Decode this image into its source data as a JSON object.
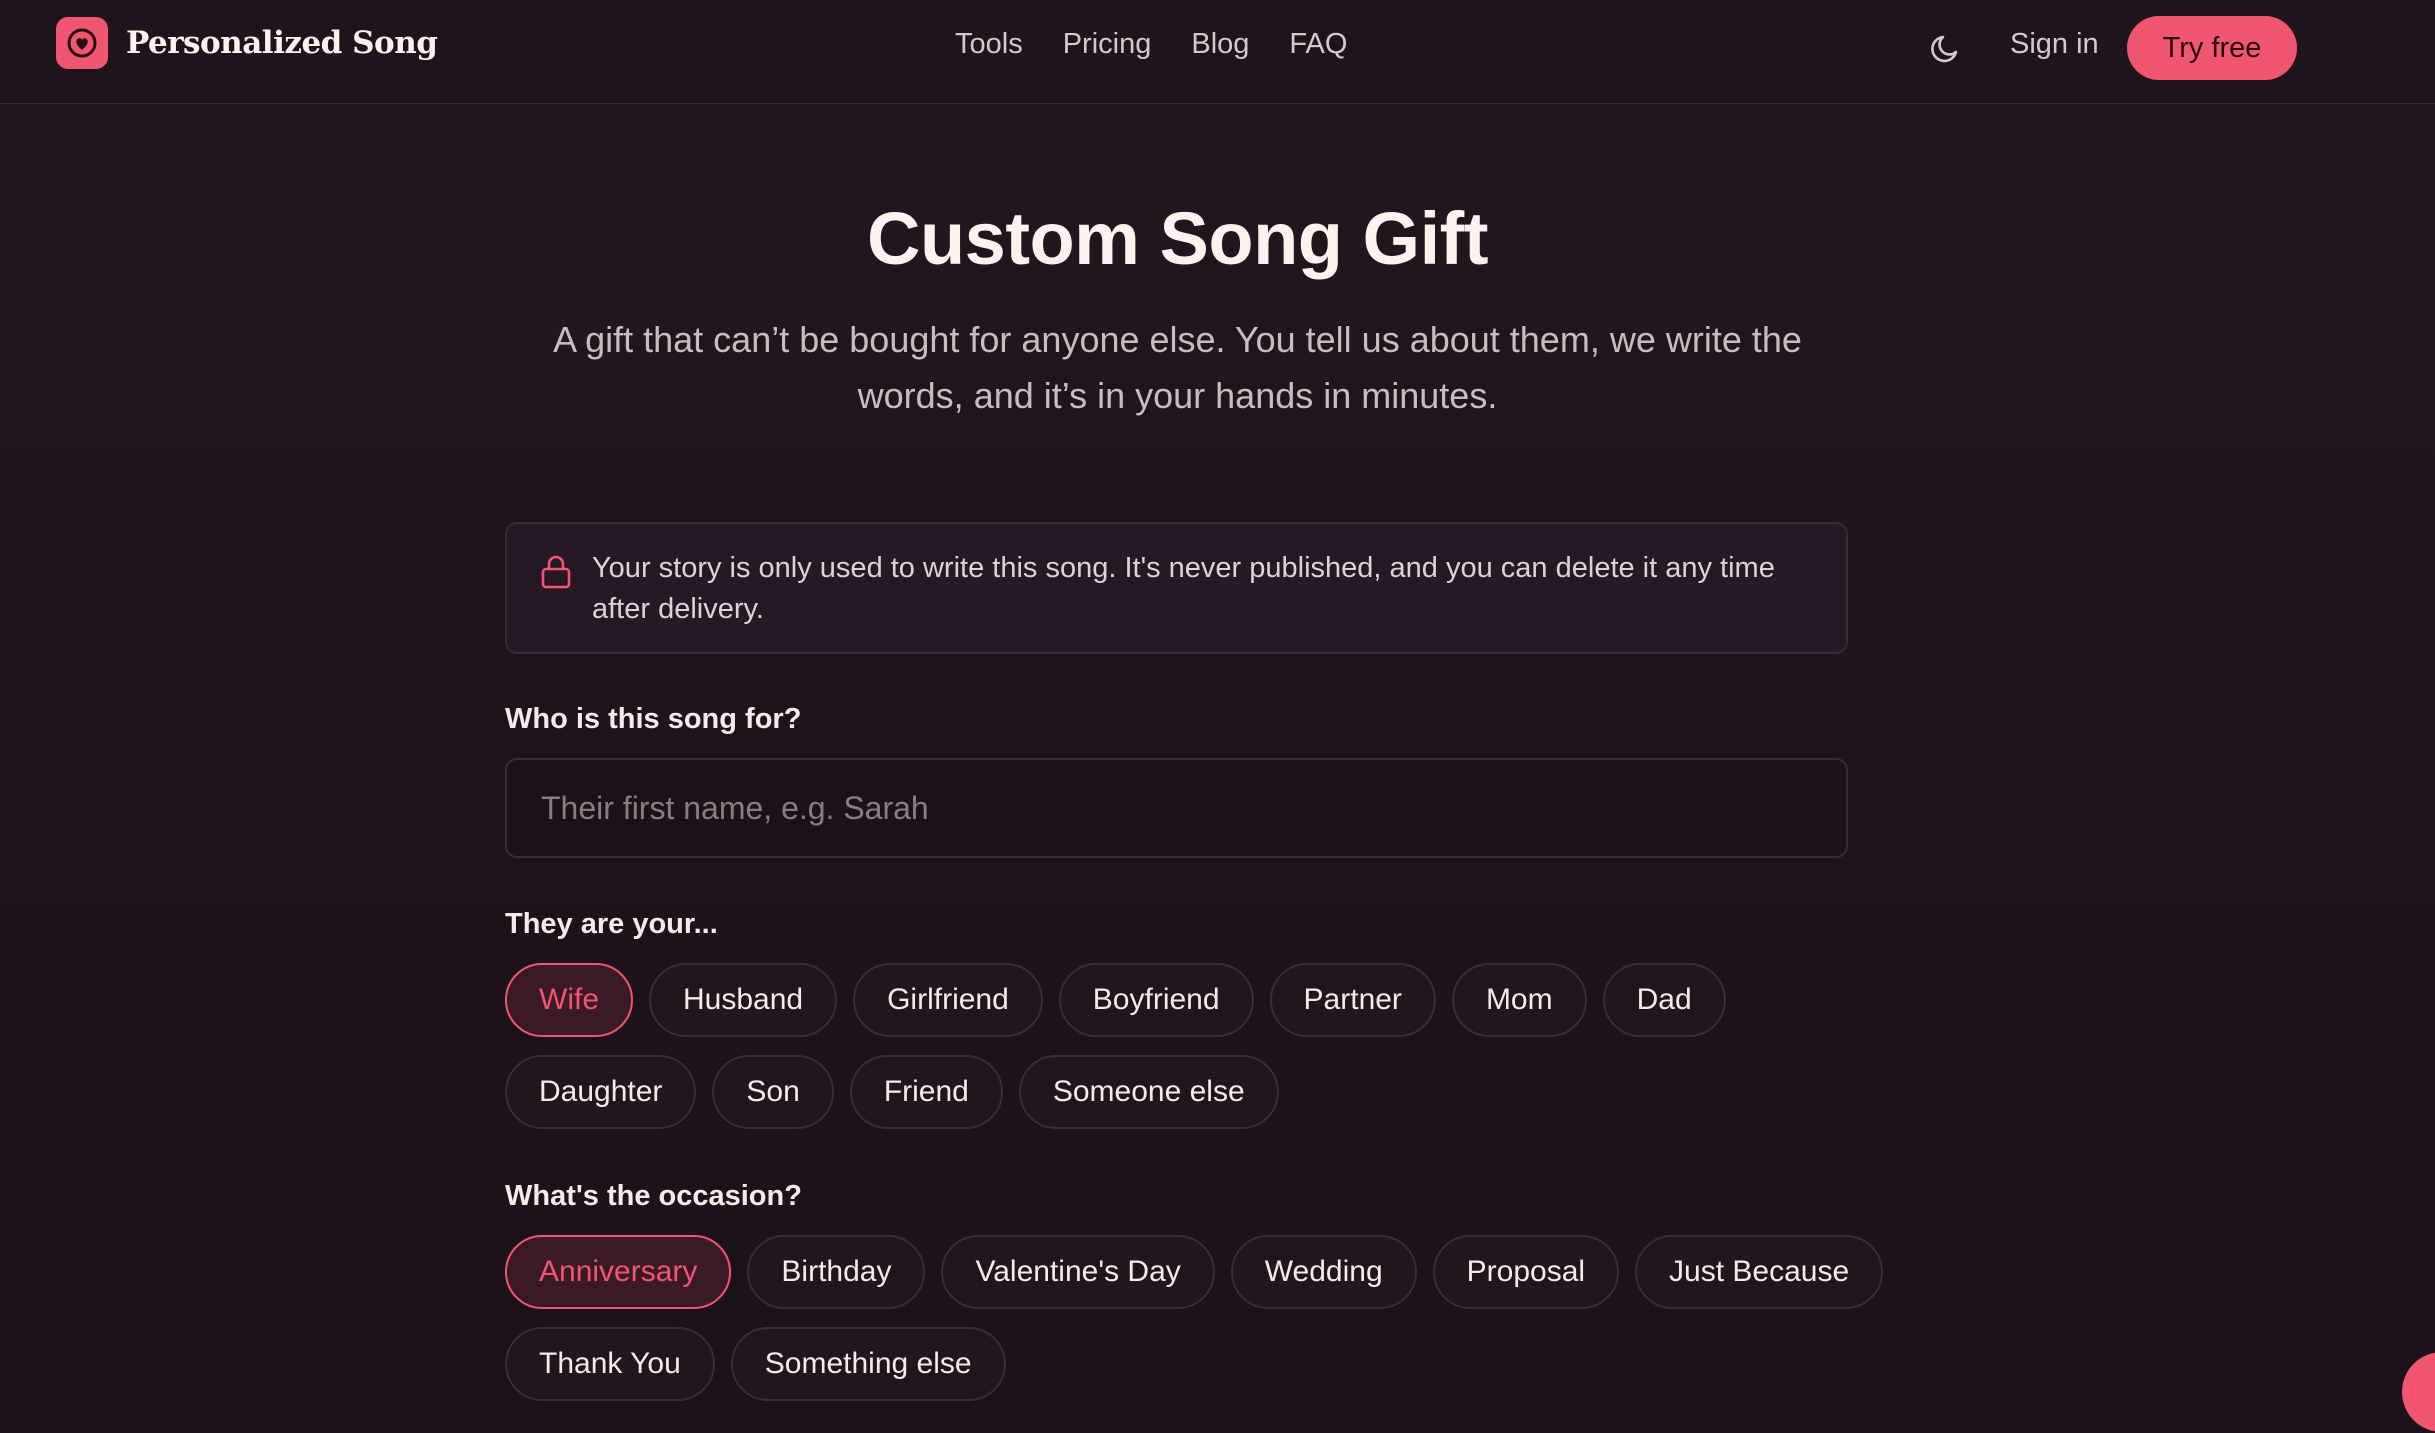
{
  "brand": {
    "name": "Personalized Song",
    "logo_icon": "heart-icon",
    "accent_color": "#f0566f"
  },
  "nav": {
    "items": [
      "Tools",
      "Pricing",
      "Blog",
      "FAQ"
    ],
    "theme_icon": "moon-icon",
    "signin_label": "Sign in",
    "try_label": "Try free"
  },
  "hero": {
    "title": "Custom Song Gift",
    "subtitle": "A gift that can’t be bought for anyone else. You tell us about them, we write the words, and it’s in your hands in minutes."
  },
  "notice": {
    "icon": "lock-icon",
    "text": "Your story is only used to write this song. It's never published, and you can delete it any time after delivery."
  },
  "form": {
    "name_label": "Who is this song for?",
    "name_placeholder": "Their first name, e.g. Sarah",
    "name_value": "",
    "relation_label": "They are your...",
    "relations": [
      "Wife",
      "Husband",
      "Girlfriend",
      "Boyfriend",
      "Partner",
      "Mom",
      "Dad",
      "Daughter",
      "Son",
      "Friend",
      "Someone else"
    ],
    "relation_selected": "Wife",
    "occasion_label": "What's the occasion?",
    "occasions": [
      "Anniversary",
      "Birthday",
      "Valentine's Day",
      "Wedding",
      "Proposal",
      "Just Because",
      "Thank You",
      "Something else"
    ],
    "occasion_selected": "Anniversary"
  }
}
